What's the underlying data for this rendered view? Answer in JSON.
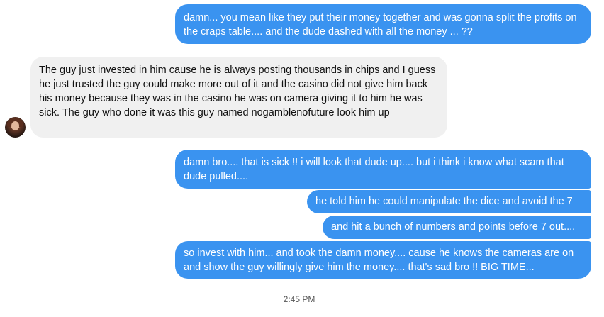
{
  "messages": [
    {
      "sender": "me",
      "text": "damn... you mean like they put their money together and was gonna split the profits on the craps table.... and the  dude dashed with all the money ... ??"
    },
    {
      "sender": "contact",
      "text": "The guy just invested in him cause he is always posting thousands in chips and I guess he just trusted the guy could make more out of it and the casino did not give him back his money because they was in the casino he was on camera giving it to him he was sick. The guy who done it was this guy named nogamblenofuture look him up"
    },
    {
      "sender": "me",
      "text": "damn bro.... that is sick !!  i will look that dude up....  but i think i know what scam that dude pulled...."
    },
    {
      "sender": "me",
      "text": "he told him he could manipulate the dice and avoid the 7"
    },
    {
      "sender": "me",
      "text": "and hit a bunch of numbers and points before 7 out...."
    },
    {
      "sender": "me",
      "text": "so invest with him... and took the damn money.... cause he knows the cameras are on and show the guy willingly give him the money.... that's sad bro !!  BIG TIME..."
    }
  ],
  "timestamp": "2:45 PM",
  "colors": {
    "outgoing_bubble": "#3a93f0",
    "incoming_bubble": "#f0f0f0"
  },
  "icons": {
    "contact_avatar": "avatar"
  }
}
